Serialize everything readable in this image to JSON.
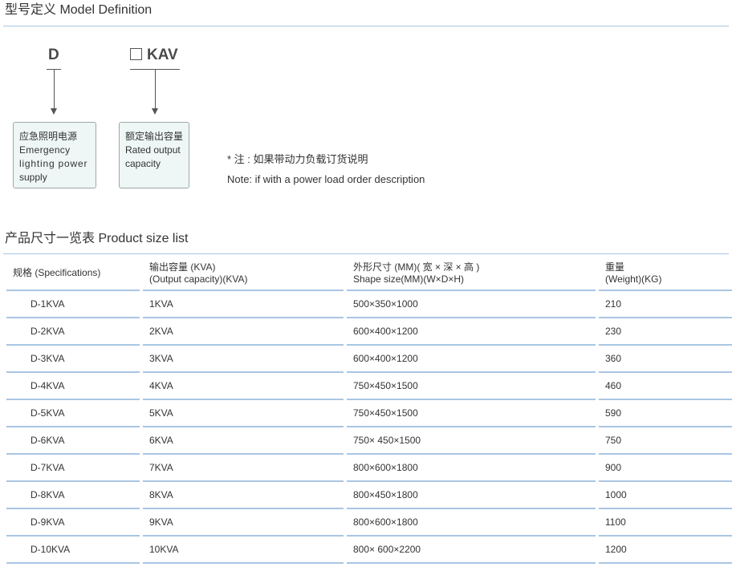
{
  "model_section": {
    "title": "型号定义 Model Definition",
    "code_d": "D",
    "code_kav": "KAV",
    "box1": {
      "cn": "应急照明电源",
      "en_lines": [
        "Emergency",
        "lighting power",
        "supply"
      ]
    },
    "box2": {
      "cn": "额定输出容量",
      "en_lines": [
        "Rated output",
        "capacity"
      ]
    },
    "note_cn": "* 注 : 如果带动力负载订货说明",
    "note_en": "Note: if with a power load order description"
  },
  "product_section": {
    "title": "产品尺寸一览表 Product size list",
    "headers": [
      [
        "规格 (Specifications)"
      ],
      [
        "输出容量 (KVA)",
        "(Output capacity)(KVA)"
      ],
      [
        "外形尺寸 (MM)( 宽 × 深 × 高 )",
        "Shape size(MM)(W×D×H)"
      ],
      [
        "重量",
        "(Weight)(KG)"
      ]
    ],
    "rows": [
      [
        "D-1KVA",
        "1KVA",
        "500×350×1000",
        "210"
      ],
      [
        "D-2KVA",
        "2KVA",
        "600×400×1200",
        "230"
      ],
      [
        "D-3KVA",
        "3KVA",
        "600×400×1200",
        "360"
      ],
      [
        "D-4KVA",
        "4KVA",
        "750×450×1500",
        "460"
      ],
      [
        "D-5KVA",
        "5KVA",
        "750×450×1500",
        "590"
      ],
      [
        "D-6KVA",
        "6KVA",
        "750× 450×1500",
        "750"
      ],
      [
        "D-7KVA",
        "7KVA",
        "800×600×1800",
        "900"
      ],
      [
        "D-8KVA",
        "8KVA",
        "800×450×1800",
        "1000"
      ],
      [
        "D-9KVA",
        "9KVA",
        "800×600×1800",
        "1100"
      ],
      [
        "D-10KVA",
        "10KVA",
        "800× 600×2200",
        "1200"
      ]
    ]
  },
  "colors": {
    "rule": "#a9c6e3",
    "box_fill": "#eef7f5",
    "box_border": "#9ba9a7",
    "text": "#333333"
  }
}
